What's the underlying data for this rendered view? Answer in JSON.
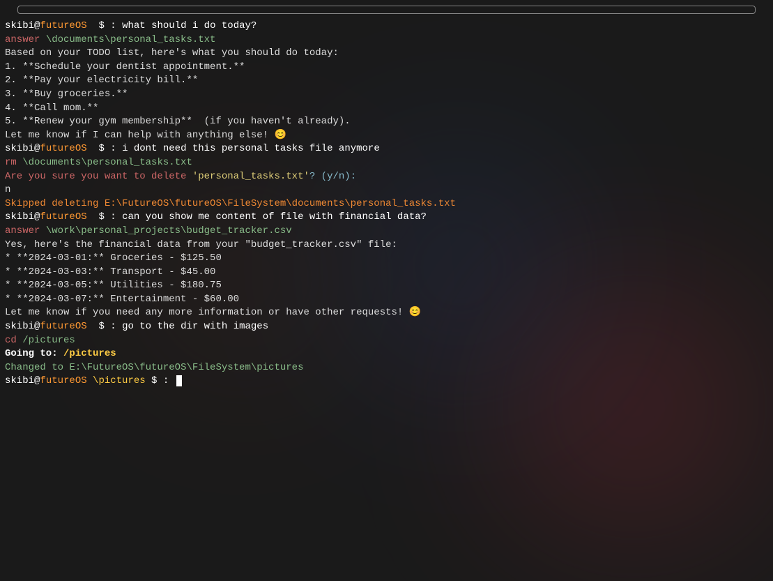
{
  "prompt": {
    "user": "skibi@",
    "host": "futureOS",
    "sep": "  $ : "
  },
  "block1": {
    "input": "what should i do today?",
    "cmd_name": "answer ",
    "cmd_path": "\\documents\\personal_tasks.txt",
    "r1": "Based on your TODO list, here's what you should do today:",
    "r2": "",
    "r3": "1. **Schedule your dentist appointment.**",
    "r4": "2. **Pay your electricity bill.**",
    "r5": "3. **Buy groceries.**",
    "r6": "4. **Call mom.**",
    "r7": "5. **Renew your gym membership**  (if you haven't already).",
    "r8": "",
    "r9": "",
    "r10": "Let me know if I can help with anything else! 😊"
  },
  "block2": {
    "input": "i dont need this personal tasks file anymore",
    "cmd_name": "rm ",
    "cmd_path": "\\documents\\personal_tasks.txt",
    "confirm_pre": "Are you sure you want to delete ",
    "confirm_file": "'personal_tasks.txt'",
    "confirm_suf": "? (y/n):",
    "answer": "n",
    "skipped": "Skipped deleting E:\\FutureOS\\futureOS\\FileSystem\\documents\\personal_tasks.txt"
  },
  "block3": {
    "input": "can you show me content of file with financial data?",
    "cmd_name": "answer ",
    "cmd_path": "\\work\\personal_projects\\budget_tracker.csv",
    "r1": "Yes, here's the financial data from your \"budget_tracker.csv\" file:",
    "r2": "",
    "r3": "* **2024-03-01:** Groceries - $125.50",
    "r4": "* **2024-03-03:** Transport - $45.00",
    "r5": "* **2024-03-05:** Utilities - $180.75",
    "r6": "* **2024-03-07:** Entertainment - $60.00",
    "r7": "",
    "r8": "",
    "r9": "Let me know if you need any more information or have other requests! 😊"
  },
  "block4": {
    "input": "go to the dir with images",
    "cmd_name": "cd ",
    "cmd_path": "/pictures",
    "blank": "",
    "going_pre": "Going to: ",
    "going_path": "/pictures",
    "changed": "Changed to E:\\FutureOS\\futureOS\\FileSystem\\pictures"
  },
  "final": {
    "cwd": " \\pictures",
    "sep": " $ : "
  }
}
